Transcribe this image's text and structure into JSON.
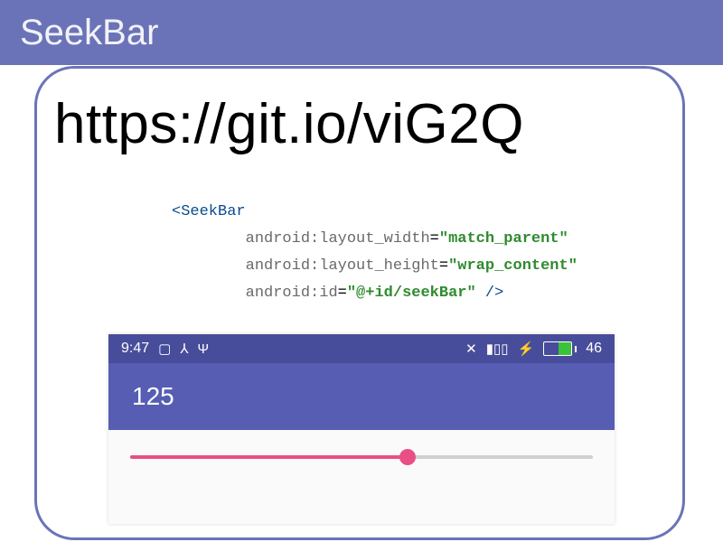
{
  "slide": {
    "title": "SeekBar",
    "url": "https://git.io/viG2Q"
  },
  "code": {
    "tag_open": "<SeekBar",
    "attr1_name": "android:layout_width",
    "attr1_value": "\"match_parent\"",
    "attr2_name": "android:layout_height",
    "attr2_value": "\"wrap_content\"",
    "attr3_name": "android:id",
    "attr3_value": "\"@+id/seekBar\"",
    "tag_close": " />"
  },
  "phone": {
    "status": {
      "time": "9:47",
      "battery_text": "46"
    },
    "value_label": "125"
  }
}
